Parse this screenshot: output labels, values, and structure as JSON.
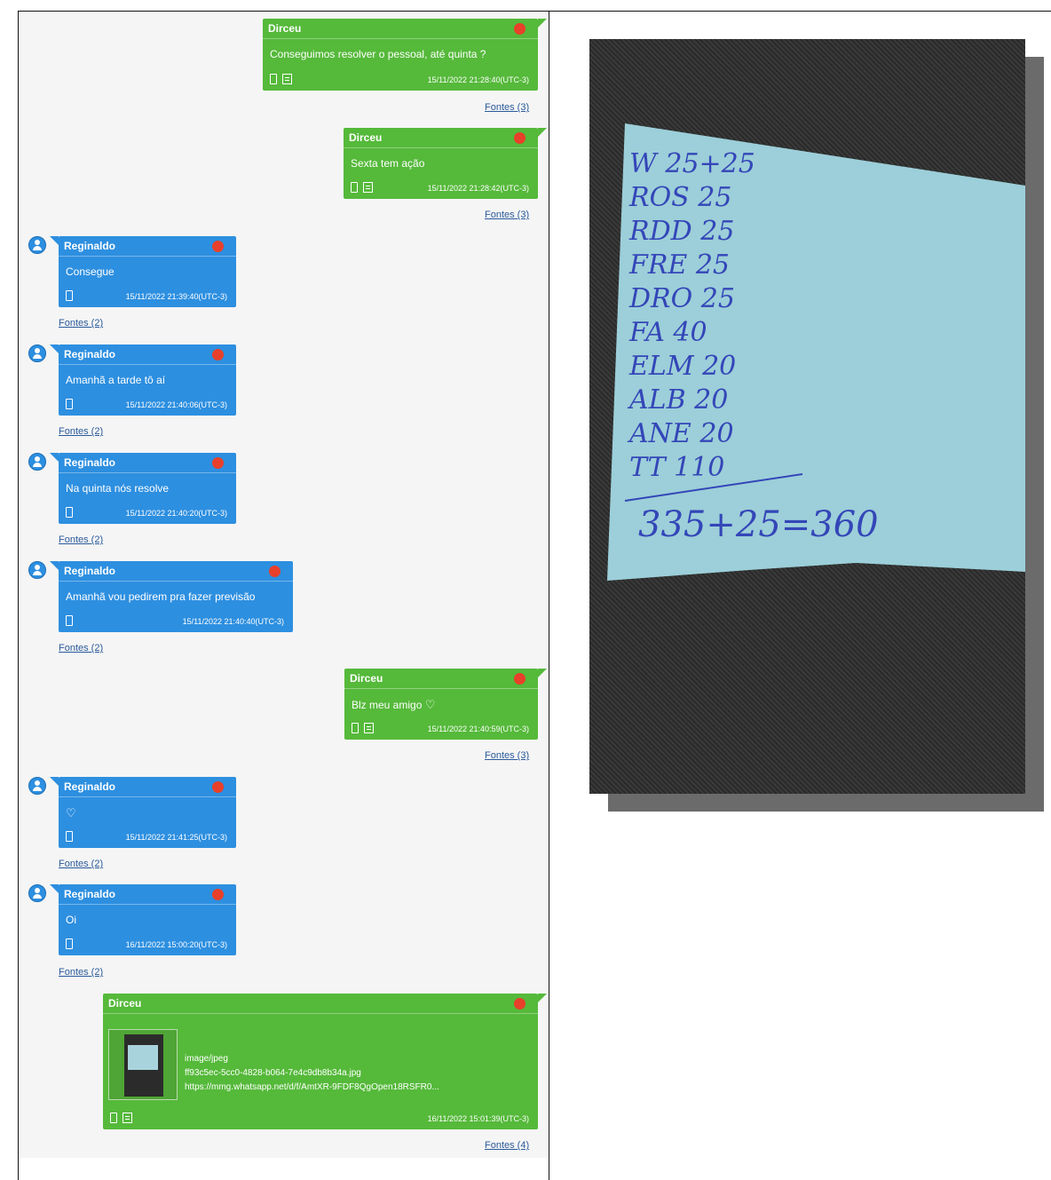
{
  "messages": [
    {
      "sender": "Dirceu",
      "text": "Conseguimos resolver o pessoal, até quinta ?",
      "timestamp": "15/11/2022 21:28:40(UTC-3)",
      "sources": "Fontes (3)"
    },
    {
      "sender": "Dirceu",
      "text": "Sexta tem ação",
      "timestamp": "15/11/2022 21:28:42(UTC-3)",
      "sources": "Fontes (3)"
    },
    {
      "sender": "Reginaldo",
      "text": "Consegue",
      "timestamp": "15/11/2022 21:39:40(UTC-3)",
      "sources": "Fontes (2)"
    },
    {
      "sender": "Reginaldo",
      "text": "Amanhã a tarde tô aí",
      "timestamp": "15/11/2022 21:40:06(UTC-3)",
      "sources": "Fontes (2)"
    },
    {
      "sender": "Reginaldo",
      "text": "Na quinta nós resolve",
      "timestamp": "15/11/2022 21:40:20(UTC-3)",
      "sources": "Fontes (2)"
    },
    {
      "sender": "Reginaldo",
      "text": "Amanhã vou pedirem pra fazer previsão",
      "timestamp": "15/11/2022 21:40:40(UTC-3)",
      "sources": "Fontes (2)"
    },
    {
      "sender": "Dirceu",
      "text": "Blz meu amigo",
      "timestamp": "15/11/2022 21:40:59(UTC-3)",
      "sources": "Fontes (3)"
    },
    {
      "sender": "Reginaldo",
      "text": "",
      "timestamp": "15/11/2022 21:41:25(UTC-3)",
      "sources": "Fontes (2)"
    },
    {
      "sender": "Reginaldo",
      "text": "Oi",
      "timestamp": "16/11/2022 15:00:20(UTC-3)",
      "sources": "Fontes (2)"
    },
    {
      "sender": "Dirceu",
      "text": "",
      "timestamp": "16/11/2022 15:01:39(UTC-3)",
      "sources": "Fontes (4)",
      "attachment": {
        "type": "image/jpeg",
        "id": "ff93c5ec-5cc0-4828-b064-7e4c9db8b34a.jpg",
        "url": "https://mmg.whatsapp.net/d/f/AmtXR-9FDF8QgOpen18RSFR0..."
      }
    }
  ],
  "photo_note": {
    "lines": [
      "W 25+25",
      "ROS 25",
      "RDD 25",
      "FRE 25",
      "DRO 25",
      "FA 40",
      "ELM 20",
      "ALB 20",
      "ANE 20",
      "TT 110",
      "335+25=360"
    ]
  },
  "colors": {
    "outgoing": "#55b93a",
    "incoming": "#2d8fe0",
    "status_dot": "#e8402a"
  }
}
